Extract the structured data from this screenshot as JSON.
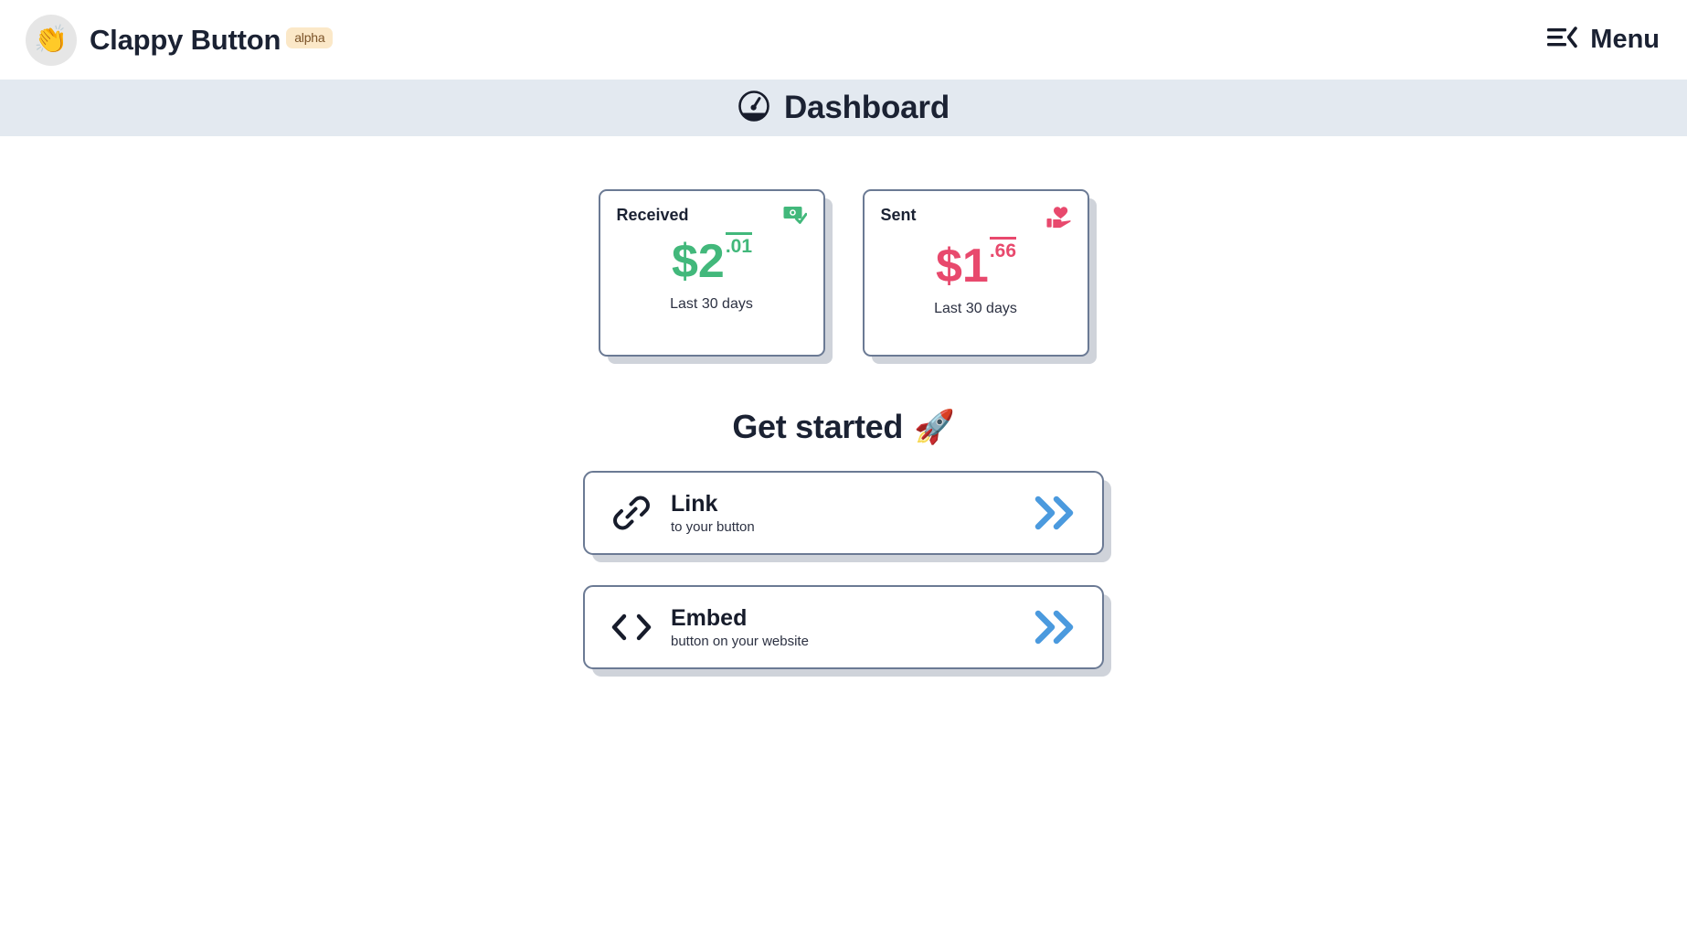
{
  "header": {
    "logo_emoji": "👏",
    "logo_icon_name": "clapping-hands-icon",
    "brand_name": "Clappy Button",
    "badge": "alpha",
    "menu_label": "Menu",
    "menu_icon_name": "hamburger-chevron-left-icon"
  },
  "page": {
    "title": "Dashboard",
    "title_icon_name": "gauge-icon",
    "band_color": "#e3e9f0"
  },
  "stats": [
    {
      "label": "Received",
      "icon_name": "money-check-icon",
      "currency": "$",
      "whole": "2",
      "cents": ".01",
      "amount_full": "$2.01",
      "period": "Last 30 days",
      "color": "#42b87b"
    },
    {
      "label": "Sent",
      "icon_name": "hand-holding-heart-icon",
      "currency": "$",
      "whole": "1",
      "cents": ".66",
      "amount_full": "$1.66",
      "period": "Last 30 days",
      "color": "#e8496d"
    }
  ],
  "get_started": {
    "heading": "Get started",
    "heading_emoji": "🚀",
    "heading_icon_name": "rocket-icon",
    "actions": [
      {
        "title": "Link",
        "subtitle": "to your button",
        "icon_name": "chain-link-icon",
        "arrow_icon_name": "double-chevron-right-icon"
      },
      {
        "title": "Embed",
        "subtitle": "button on your website",
        "icon_name": "code-brackets-icon",
        "arrow_icon_name": "double-chevron-right-icon"
      }
    ]
  },
  "colors": {
    "accent_blue": "#4b9ade",
    "received_green": "#42b87b",
    "sent_pink": "#e8496d",
    "badge_bg": "#fbe8c8",
    "badge_text": "#7a5227",
    "card_border": "#6b7a94",
    "card_shadow": "#cfd3da",
    "text_dark": "#1b2233"
  }
}
